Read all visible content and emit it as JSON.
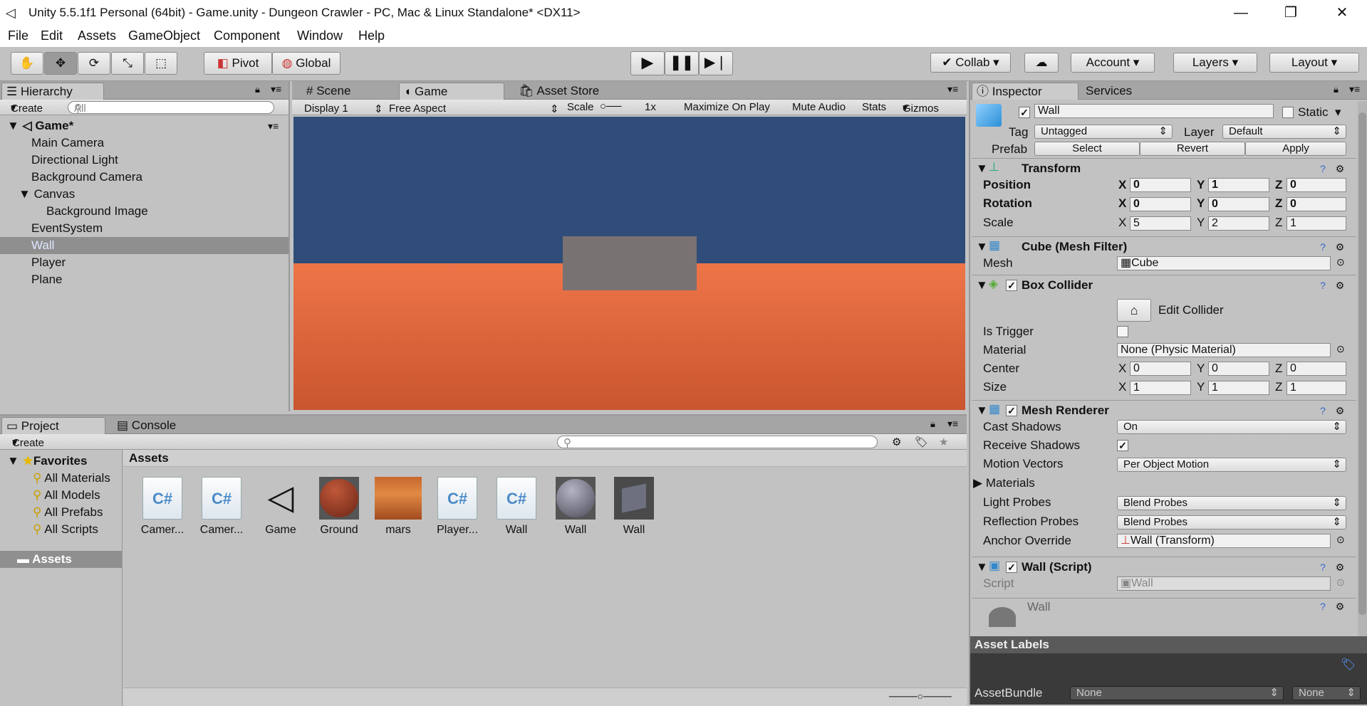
{
  "window": {
    "title": "Unity 5.5.1f1 Personal (64bit) - Game.unity - Dungeon Crawler - PC, Mac & Linux Standalone* <DX11>",
    "minimize": "—",
    "maximize": "❐",
    "close": "✕"
  },
  "menu": [
    "File",
    "Edit",
    "Assets",
    "GameObject",
    "Component",
    "Window",
    "Help"
  ],
  "toolbar": {
    "pivot": "Pivot",
    "global": "Global",
    "collab": "Collab",
    "account": "Account",
    "layers": "Layers",
    "layout": "Layout"
  },
  "hierarchy": {
    "tab": "Hierarchy",
    "create": "Create",
    "search_placeholder": "All",
    "scene": "Game*",
    "items": [
      "Main Camera",
      "Directional Light",
      "Background Camera",
      "Canvas",
      "Background Image",
      "EventSystem",
      "Wall",
      "Player",
      "Plane"
    ],
    "selected": "Wall"
  },
  "center_tabs": {
    "scene": "Scene",
    "game": "Game",
    "asset_store": "Asset Store"
  },
  "game_toolbar": {
    "display": "Display 1",
    "aspect": "Free Aspect",
    "scale_label": "Scale",
    "scale_value": "1x",
    "maximize": "Maximize On Play",
    "mute": "Mute Audio",
    "stats": "Stats",
    "gizmos": "Gizmos"
  },
  "project": {
    "tab_project": "Project",
    "tab_console": "Console",
    "create": "Create",
    "favorites": "Favorites",
    "favorite_items": [
      "All Materials",
      "All Models",
      "All Prefabs",
      "All Scripts"
    ],
    "assets_folder": "Assets",
    "breadcrumb": "Assets",
    "assets": [
      {
        "name": "Camer...",
        "kind": "script"
      },
      {
        "name": "Camer...",
        "kind": "script"
      },
      {
        "name": "Game",
        "kind": "unity-scene"
      },
      {
        "name": "Ground",
        "kind": "material-red"
      },
      {
        "name": "mars",
        "kind": "texture"
      },
      {
        "name": "Player...",
        "kind": "script"
      },
      {
        "name": "Wall",
        "kind": "script"
      },
      {
        "name": "Wall",
        "kind": "material-grey"
      },
      {
        "name": "Wall",
        "kind": "prefab"
      }
    ]
  },
  "inspector": {
    "tab": "Inspector",
    "services": "Services",
    "object_name": "Wall",
    "static": "Static",
    "tag_label": "Tag",
    "tag": "Untagged",
    "layer_label": "Layer",
    "layer": "Default",
    "prefab_label": "Prefab",
    "prefab_buttons": [
      "Select",
      "Revert",
      "Apply"
    ],
    "transform": {
      "title": "Transform",
      "position_label": "Position",
      "rotation_label": "Rotation",
      "scale_label": "Scale",
      "position": [
        "0",
        "1",
        "0"
      ],
      "rotation": [
        "0",
        "0",
        "0"
      ],
      "scale": [
        "5",
        "2",
        "1"
      ]
    },
    "mesh_filter": {
      "title": "Cube (Mesh Filter)",
      "mesh_label": "Mesh",
      "mesh": "Cube"
    },
    "box_collider": {
      "title": "Box Collider",
      "edit_collider": "Edit Collider",
      "is_trigger": "Is Trigger",
      "material_label": "Material",
      "material": "None (Physic Material)",
      "center_label": "Center",
      "center": [
        "0",
        "0",
        "0"
      ],
      "size_label": "Size",
      "size": [
        "1",
        "1",
        "1"
      ]
    },
    "mesh_renderer": {
      "title": "Mesh Renderer",
      "cast_shadows_label": "Cast Shadows",
      "cast_shadows": "On",
      "receive_shadows_label": "Receive Shadows",
      "motion_vectors_label": "Motion Vectors",
      "motion_vectors": "Per Object Motion",
      "materials_label": "Materials",
      "light_probes_label": "Light Probes",
      "light_probes": "Blend Probes",
      "reflection_probes_label": "Reflection Probes",
      "reflection_probes": "Blend Probes",
      "anchor_override_label": "Anchor Override",
      "anchor_override": "Wall (Transform)"
    },
    "wall_script": {
      "title": "Wall (Script)",
      "script_label": "Script",
      "script": "Wall"
    },
    "partial_material": "Wall",
    "asset_labels": "Asset Labels",
    "assetbundle_label": "AssetBundle",
    "assetbundle": "None",
    "assetbundle_variant": "None"
  }
}
